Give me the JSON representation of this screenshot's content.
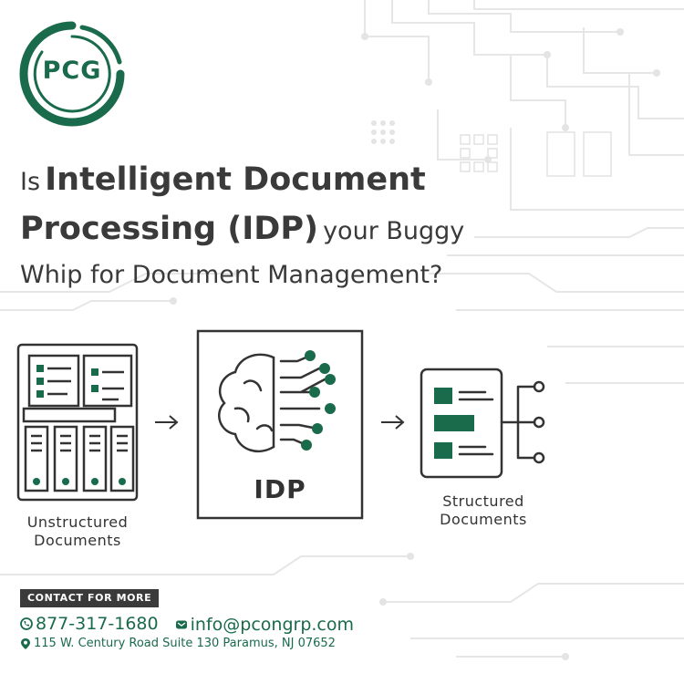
{
  "brand": {
    "logo_text": "PCG",
    "color_green": "#1a6a4c",
    "color_dark": "#3a3a3a"
  },
  "headline": {
    "line1_prefix": "Is",
    "line1_bold": "Intelligent Document",
    "line2_bold": "Processing (IDP)",
    "line2_suffix": "your Buggy",
    "line3": "Whip for Document Management?"
  },
  "diagram": {
    "left_caption_1": "Unstructured",
    "left_caption_2": "Documents",
    "center_label": "IDP",
    "right_caption_1": "Structured",
    "right_caption_2": "Documents",
    "icons": [
      "document-stack-icon",
      "arrow-right-icon",
      "brain-circuit-icon",
      "structured-document-icon"
    ]
  },
  "contact": {
    "badge": "CONTACT FOR MORE",
    "phone": "877-317-1680",
    "email": "info@pcongrp.com",
    "address": "115 W. Century Road Suite 130 Paramus, NJ 07652"
  }
}
